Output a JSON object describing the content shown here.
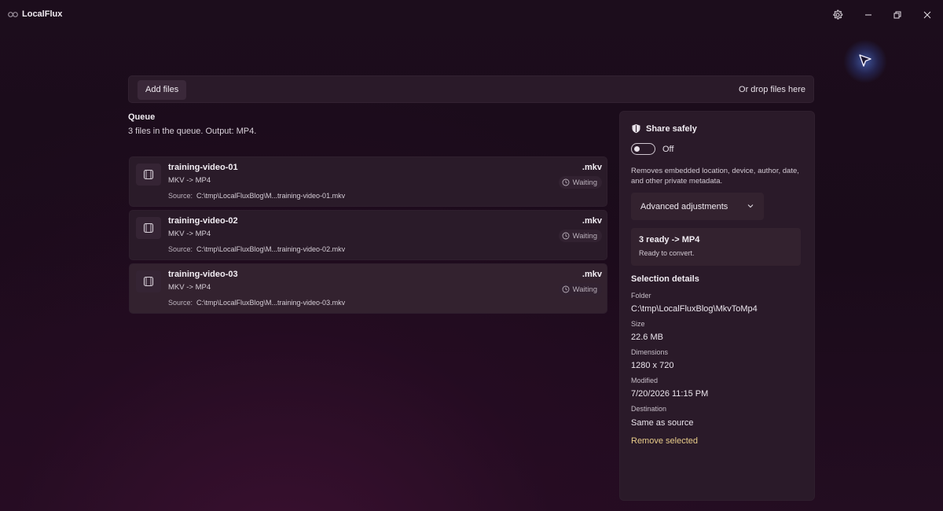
{
  "app": {
    "title": "LocalFlux",
    "logo_icon": "app-logo-icon"
  },
  "titlebar": {
    "settings_icon": "gear-icon",
    "minimize_icon": "minimize-icon",
    "restore_icon": "restore-icon",
    "close_icon": "close-icon"
  },
  "dropbar": {
    "add_label": "Add files",
    "hint": "Or drop files here"
  },
  "queue": {
    "title": "Queue",
    "summary": "3 files in the queue. Output: MP4.",
    "source_label": "Source:",
    "items": [
      {
        "name": "training-video-01",
        "conversion": "MKV -> MP4",
        "source": "C:\\tmp\\LocalFluxBlog\\M...training-video-01.mkv",
        "ext": ".mkv",
        "status": "Waiting"
      },
      {
        "name": "training-video-02",
        "conversion": "MKV -> MP4",
        "source": "C:\\tmp\\LocalFluxBlog\\M...training-video-02.mkv",
        "ext": ".mkv",
        "status": "Waiting"
      },
      {
        "name": "training-video-03",
        "conversion": "MKV -> MP4",
        "source": "C:\\tmp\\LocalFluxBlog\\M...training-video-03.mkv",
        "ext": ".mkv",
        "status": "Waiting"
      }
    ]
  },
  "sidebar": {
    "share_title": "Share safely",
    "toggle_state": "Off",
    "share_description": "Removes embedded location, device, author, date, and other private metadata.",
    "advanced_label": "Advanced adjustments",
    "ready_title": "3 ready -> MP4",
    "ready_subtitle": "Ready to convert.",
    "selection_title": "Selection details",
    "details": {
      "folder_label": "Folder",
      "folder_value": "C:\\tmp\\LocalFluxBlog\\MkvToMp4",
      "size_label": "Size",
      "size_value": "22.6 MB",
      "dimensions_label": "Dimensions",
      "dimensions_value": "1280 x 720",
      "modified_label": "Modified",
      "modified_value": "7/20/2026 11:15 PM",
      "destination_label": "Destination",
      "destination_value": "Same as source"
    },
    "remove_label": "Remove selected"
  },
  "colors": {
    "accent_link": "#e8cc8a",
    "cursor_glow": "#5a8cff"
  }
}
